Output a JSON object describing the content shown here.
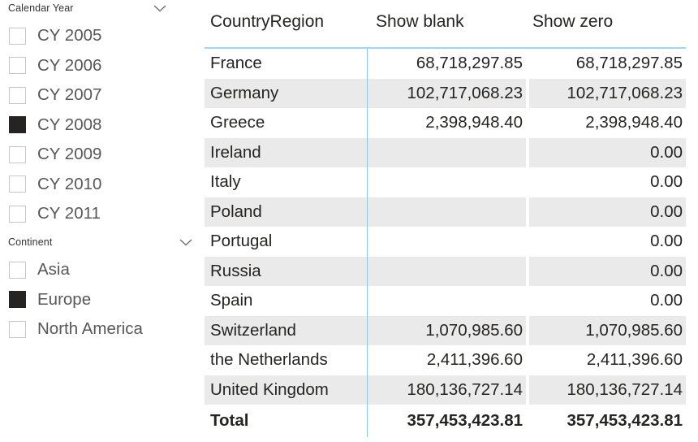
{
  "slicers": [
    {
      "name": "calendar-year",
      "title": "Calendar Year",
      "expand_icon": "chevron-down-icon",
      "items": [
        {
          "label": "CY 2005",
          "checked": false
        },
        {
          "label": "CY 2006",
          "checked": false
        },
        {
          "label": "CY 2007",
          "checked": false
        },
        {
          "label": "CY 2008",
          "checked": true
        },
        {
          "label": "CY 2009",
          "checked": false
        },
        {
          "label": "CY 2010",
          "checked": false
        },
        {
          "label": "CY 2011",
          "checked": false
        }
      ]
    },
    {
      "name": "continent",
      "title": "Continent",
      "expand_icon": "chevron-down-icon",
      "items": [
        {
          "label": "Asia",
          "checked": false
        },
        {
          "label": "Europe",
          "checked": true
        },
        {
          "label": "North America",
          "checked": false
        }
      ]
    }
  ],
  "matrix": {
    "columns": [
      {
        "key": "country",
        "label": "CountryRegion",
        "align": "left"
      },
      {
        "key": "show_blank",
        "label": "Show blank",
        "align": "right"
      },
      {
        "key": "show_zero",
        "label": "Show zero",
        "align": "right"
      }
    ],
    "rows": [
      {
        "country": "France",
        "show_blank": "68,718,297.85",
        "show_zero": "68,718,297.85"
      },
      {
        "country": "Germany",
        "show_blank": "102,717,068.23",
        "show_zero": "102,717,068.23"
      },
      {
        "country": "Greece",
        "show_blank": "2,398,948.40",
        "show_zero": "2,398,948.40"
      },
      {
        "country": "Ireland",
        "show_blank": "",
        "show_zero": "0.00"
      },
      {
        "country": "Italy",
        "show_blank": "",
        "show_zero": "0.00"
      },
      {
        "country": "Poland",
        "show_blank": "",
        "show_zero": "0.00"
      },
      {
        "country": "Portugal",
        "show_blank": "",
        "show_zero": "0.00"
      },
      {
        "country": "Russia",
        "show_blank": "",
        "show_zero": "0.00"
      },
      {
        "country": "Spain",
        "show_blank": "",
        "show_zero": "0.00"
      },
      {
        "country": "Switzerland",
        "show_blank": "1,070,985.60",
        "show_zero": "1,070,985.60"
      },
      {
        "country": "the Netherlands",
        "show_blank": "2,411,396.60",
        "show_zero": "2,411,396.60"
      },
      {
        "country": "United Kingdom",
        "show_blank": "180,136,727.14",
        "show_zero": "180,136,727.14"
      }
    ],
    "total": {
      "country": "Total",
      "show_blank": "357,453,423.81",
      "show_zero": "357,453,423.81"
    }
  },
  "colors": {
    "header_rule": "#a6d4ef",
    "column_divider": "#8ec5e8",
    "stripe": "#eaeaea",
    "checkbox_checked": "#252423",
    "checkbox_border": "#c8c6c4",
    "text": "#252423",
    "slicer_label": "#585858"
  }
}
